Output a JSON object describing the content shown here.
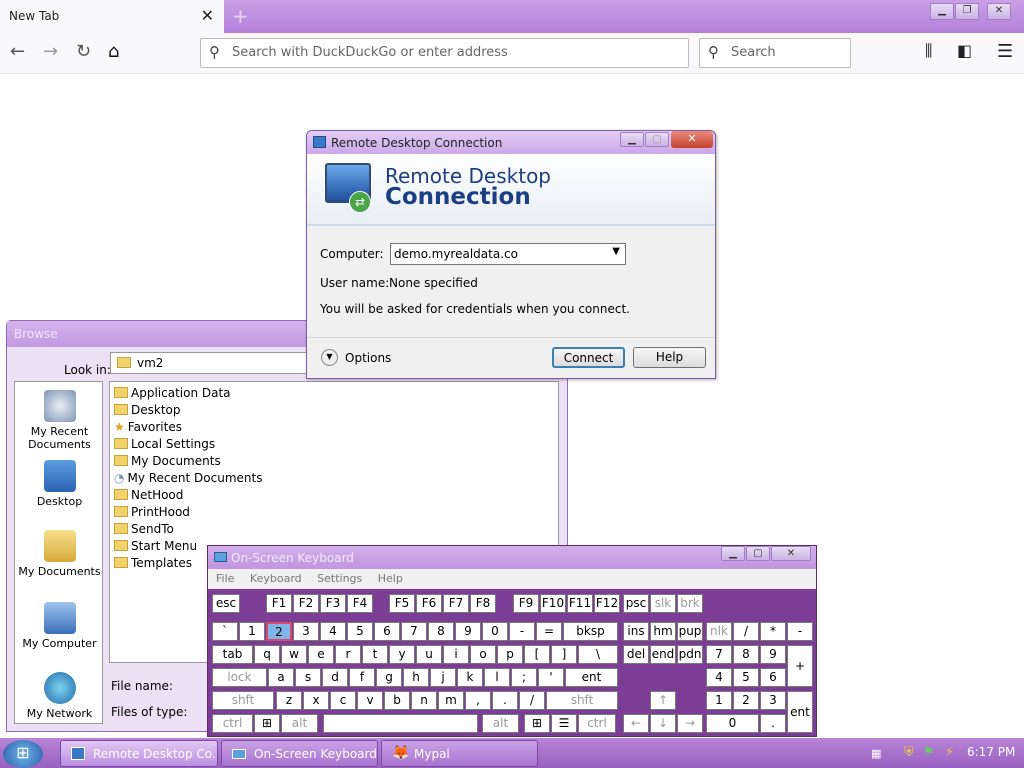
{
  "browser": {
    "tab_title": "New Tab",
    "tab_close": "✕",
    "new_tab": "+",
    "url_placeholder": "Search with DuckDuckGo or enter address",
    "search_placeholder": "Search"
  },
  "browse": {
    "title": "Browse",
    "look_in_label": "Look in:",
    "look_in_value": "vm2",
    "places": [
      "My Recent Documents",
      "Desktop",
      "My Documents",
      "My Computer",
      "My Network"
    ],
    "files": [
      "Application Data",
      "Desktop",
      "Favorites",
      "Local Settings",
      "My Documents",
      "My Recent Documents",
      "NetHood",
      "PrintHood",
      "SendTo",
      "Start Menu",
      "Templates"
    ],
    "file_name_label": "File name:",
    "files_of_type_label": "Files of type:"
  },
  "rdc": {
    "window_title": "Remote Desktop Connection",
    "banner_line1": "Remote Desktop",
    "banner_line2": "Connection",
    "computer_label": "Computer:",
    "computer_value": "demo.myrealdata.co",
    "username_label": "User name:",
    "username_value": "None specified",
    "info_text": "You will be asked for credentials when you connect.",
    "options_label": "Options",
    "connect_label": "Connect",
    "help_label": "Help"
  },
  "osk": {
    "title": "On-Screen Keyboard",
    "menu": [
      "File",
      "Keyboard",
      "Settings",
      "Help"
    ],
    "rows": {
      "r0": [
        "esc",
        "F1",
        "F2",
        "F3",
        "F4",
        "F5",
        "F6",
        "F7",
        "F8",
        "F9",
        "F10",
        "F11",
        "F12",
        "psc",
        "slk",
        "brk"
      ],
      "r1": [
        "`",
        "1",
        "2",
        "3",
        "4",
        "5",
        "6",
        "7",
        "8",
        "9",
        "0",
        "-",
        "=",
        "bksp",
        "ins",
        "hm",
        "pup",
        "nlk",
        "/",
        "*",
        "-"
      ],
      "r2": [
        "tab",
        "q",
        "w",
        "e",
        "r",
        "t",
        "y",
        "u",
        "i",
        "o",
        "p",
        "[",
        "]",
        "\\",
        "del",
        "end",
        "pdn",
        "7",
        "8",
        "9",
        "+"
      ],
      "r3": [
        "lock",
        "a",
        "s",
        "d",
        "f",
        "g",
        "h",
        "j",
        "k",
        "l",
        ";",
        "'",
        "ent",
        "4",
        "5",
        "6"
      ],
      "r4": [
        "shft",
        "z",
        "x",
        "c",
        "v",
        "b",
        "n",
        "m",
        ",",
        ".",
        "/",
        "shft",
        "↑",
        "1",
        "2",
        "3",
        "ent"
      ],
      "r5": [
        "ctrl",
        "⊞",
        "alt",
        "",
        "alt",
        "⊞",
        "☰",
        "ctrl",
        "←",
        "↓",
        "→",
        "0",
        "."
      ]
    }
  },
  "taskbar": {
    "items": [
      "Remote Desktop Co...",
      "On-Screen Keyboard",
      "Mypal"
    ],
    "clock": "6:17 PM"
  }
}
